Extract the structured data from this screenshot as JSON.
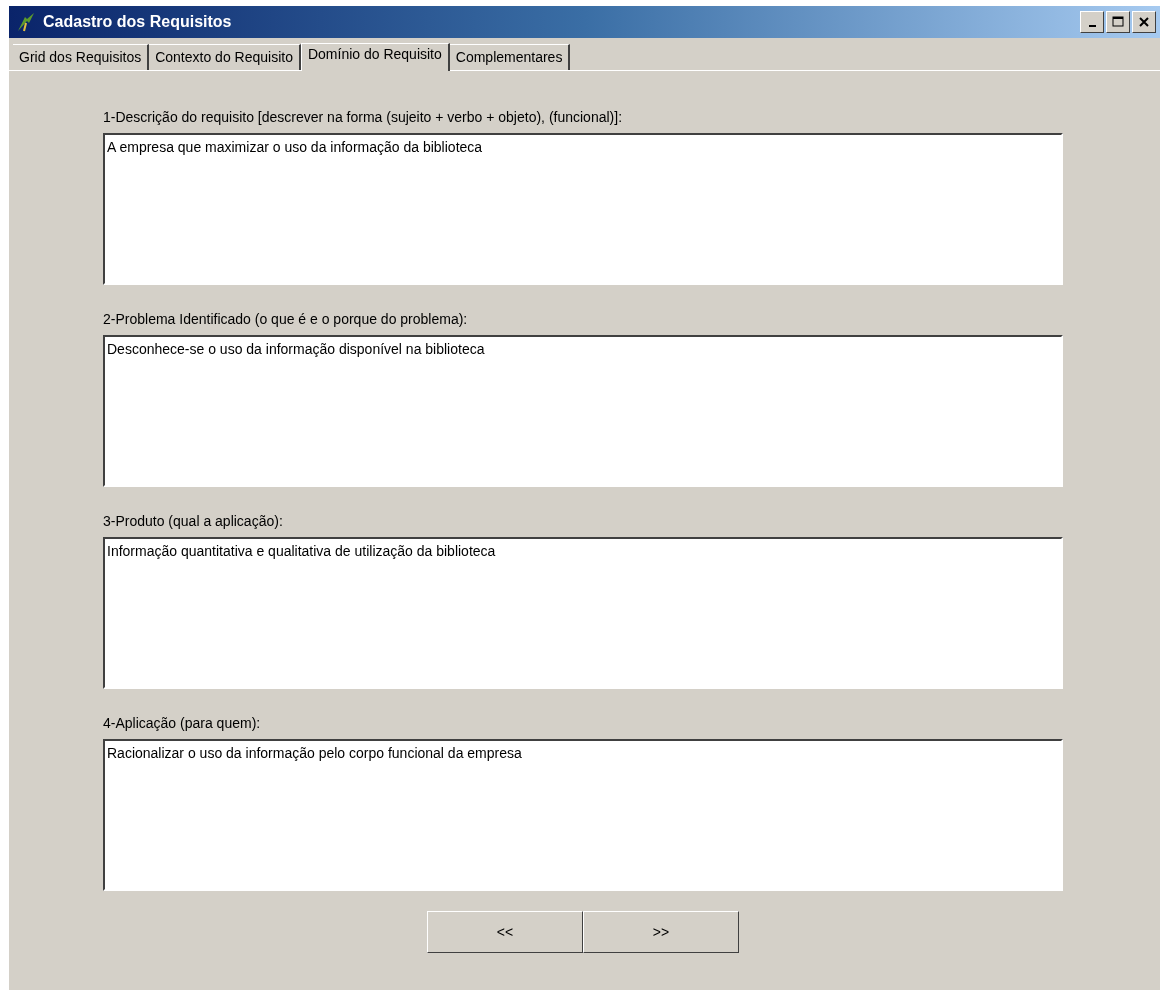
{
  "window": {
    "title": "Cadastro dos Requisitos"
  },
  "tabs": [
    {
      "label": "Grid dos Requisitos",
      "selected": false
    },
    {
      "label": "Contexto do Requisito",
      "selected": false
    },
    {
      "label": "Domínio do Requisito",
      "selected": true
    },
    {
      "label": "Complementares",
      "selected": false
    }
  ],
  "fields": [
    {
      "label": "1-Descrição do requisito [descrever na forma (sujeito + verbo + objeto), (funcional)]:",
      "value": "A empresa que maximizar o uso da informação da biblioteca"
    },
    {
      "label": "2-Problema Identificado (o que é  e o porque do problema):",
      "value": "Desconhece-se o uso da informação disponível na biblioteca"
    },
    {
      "label": "3-Produto (qual a aplicação):",
      "value": "Informação quantitativa e qualitativa de utilização da biblioteca"
    },
    {
      "label": "4-Aplicação (para quem):",
      "value": "Racionalizar o uso da informação pelo corpo funcional da empresa"
    }
  ],
  "buttons": [
    "<<",
    ">>"
  ]
}
